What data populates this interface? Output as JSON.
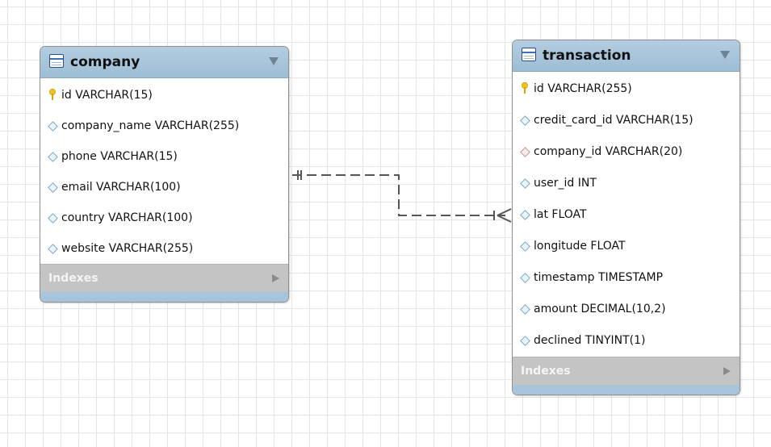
{
  "tables": {
    "company": {
      "name": "company",
      "columns": [
        {
          "text": "id VARCHAR(15)",
          "key": "primary"
        },
        {
          "text": "company_name VARCHAR(255)",
          "key": "none"
        },
        {
          "text": "phone VARCHAR(15)",
          "key": "none"
        },
        {
          "text": "email VARCHAR(100)",
          "key": "none"
        },
        {
          "text": "country VARCHAR(100)",
          "key": "none"
        },
        {
          "text": "website VARCHAR(255)",
          "key": "none"
        }
      ],
      "indexes_label": "Indexes"
    },
    "transaction": {
      "name": "transaction",
      "columns": [
        {
          "text": "id VARCHAR(255)",
          "key": "primary"
        },
        {
          "text": "credit_card_id VARCHAR(15)",
          "key": "none"
        },
        {
          "text": "company_id VARCHAR(20)",
          "key": "foreign"
        },
        {
          "text": "user_id INT",
          "key": "none"
        },
        {
          "text": "lat FLOAT",
          "key": "none"
        },
        {
          "text": "longitude FLOAT",
          "key": "none"
        },
        {
          "text": "timestamp TIMESTAMP",
          "key": "none"
        },
        {
          "text": "amount DECIMAL(10,2)",
          "key": "none"
        },
        {
          "text": "declined TINYINT(1)",
          "key": "none"
        }
      ],
      "indexes_label": "Indexes"
    }
  },
  "relationship": {
    "from": "company",
    "to": "transaction",
    "from_cardinality": "one-and-only-one",
    "to_cardinality": "one-or-many",
    "line_style": "dashed"
  },
  "colors": {
    "header": "#a9c6dc",
    "footer": "#a6c4da",
    "indexes_bar": "#c4c4c4",
    "grid": "#e4e4e4",
    "relation_line": "#555555",
    "pk_icon": "#f2c21b",
    "fk_diamond": "#c98f8f",
    "column_diamond": "#7aa8c6"
  }
}
